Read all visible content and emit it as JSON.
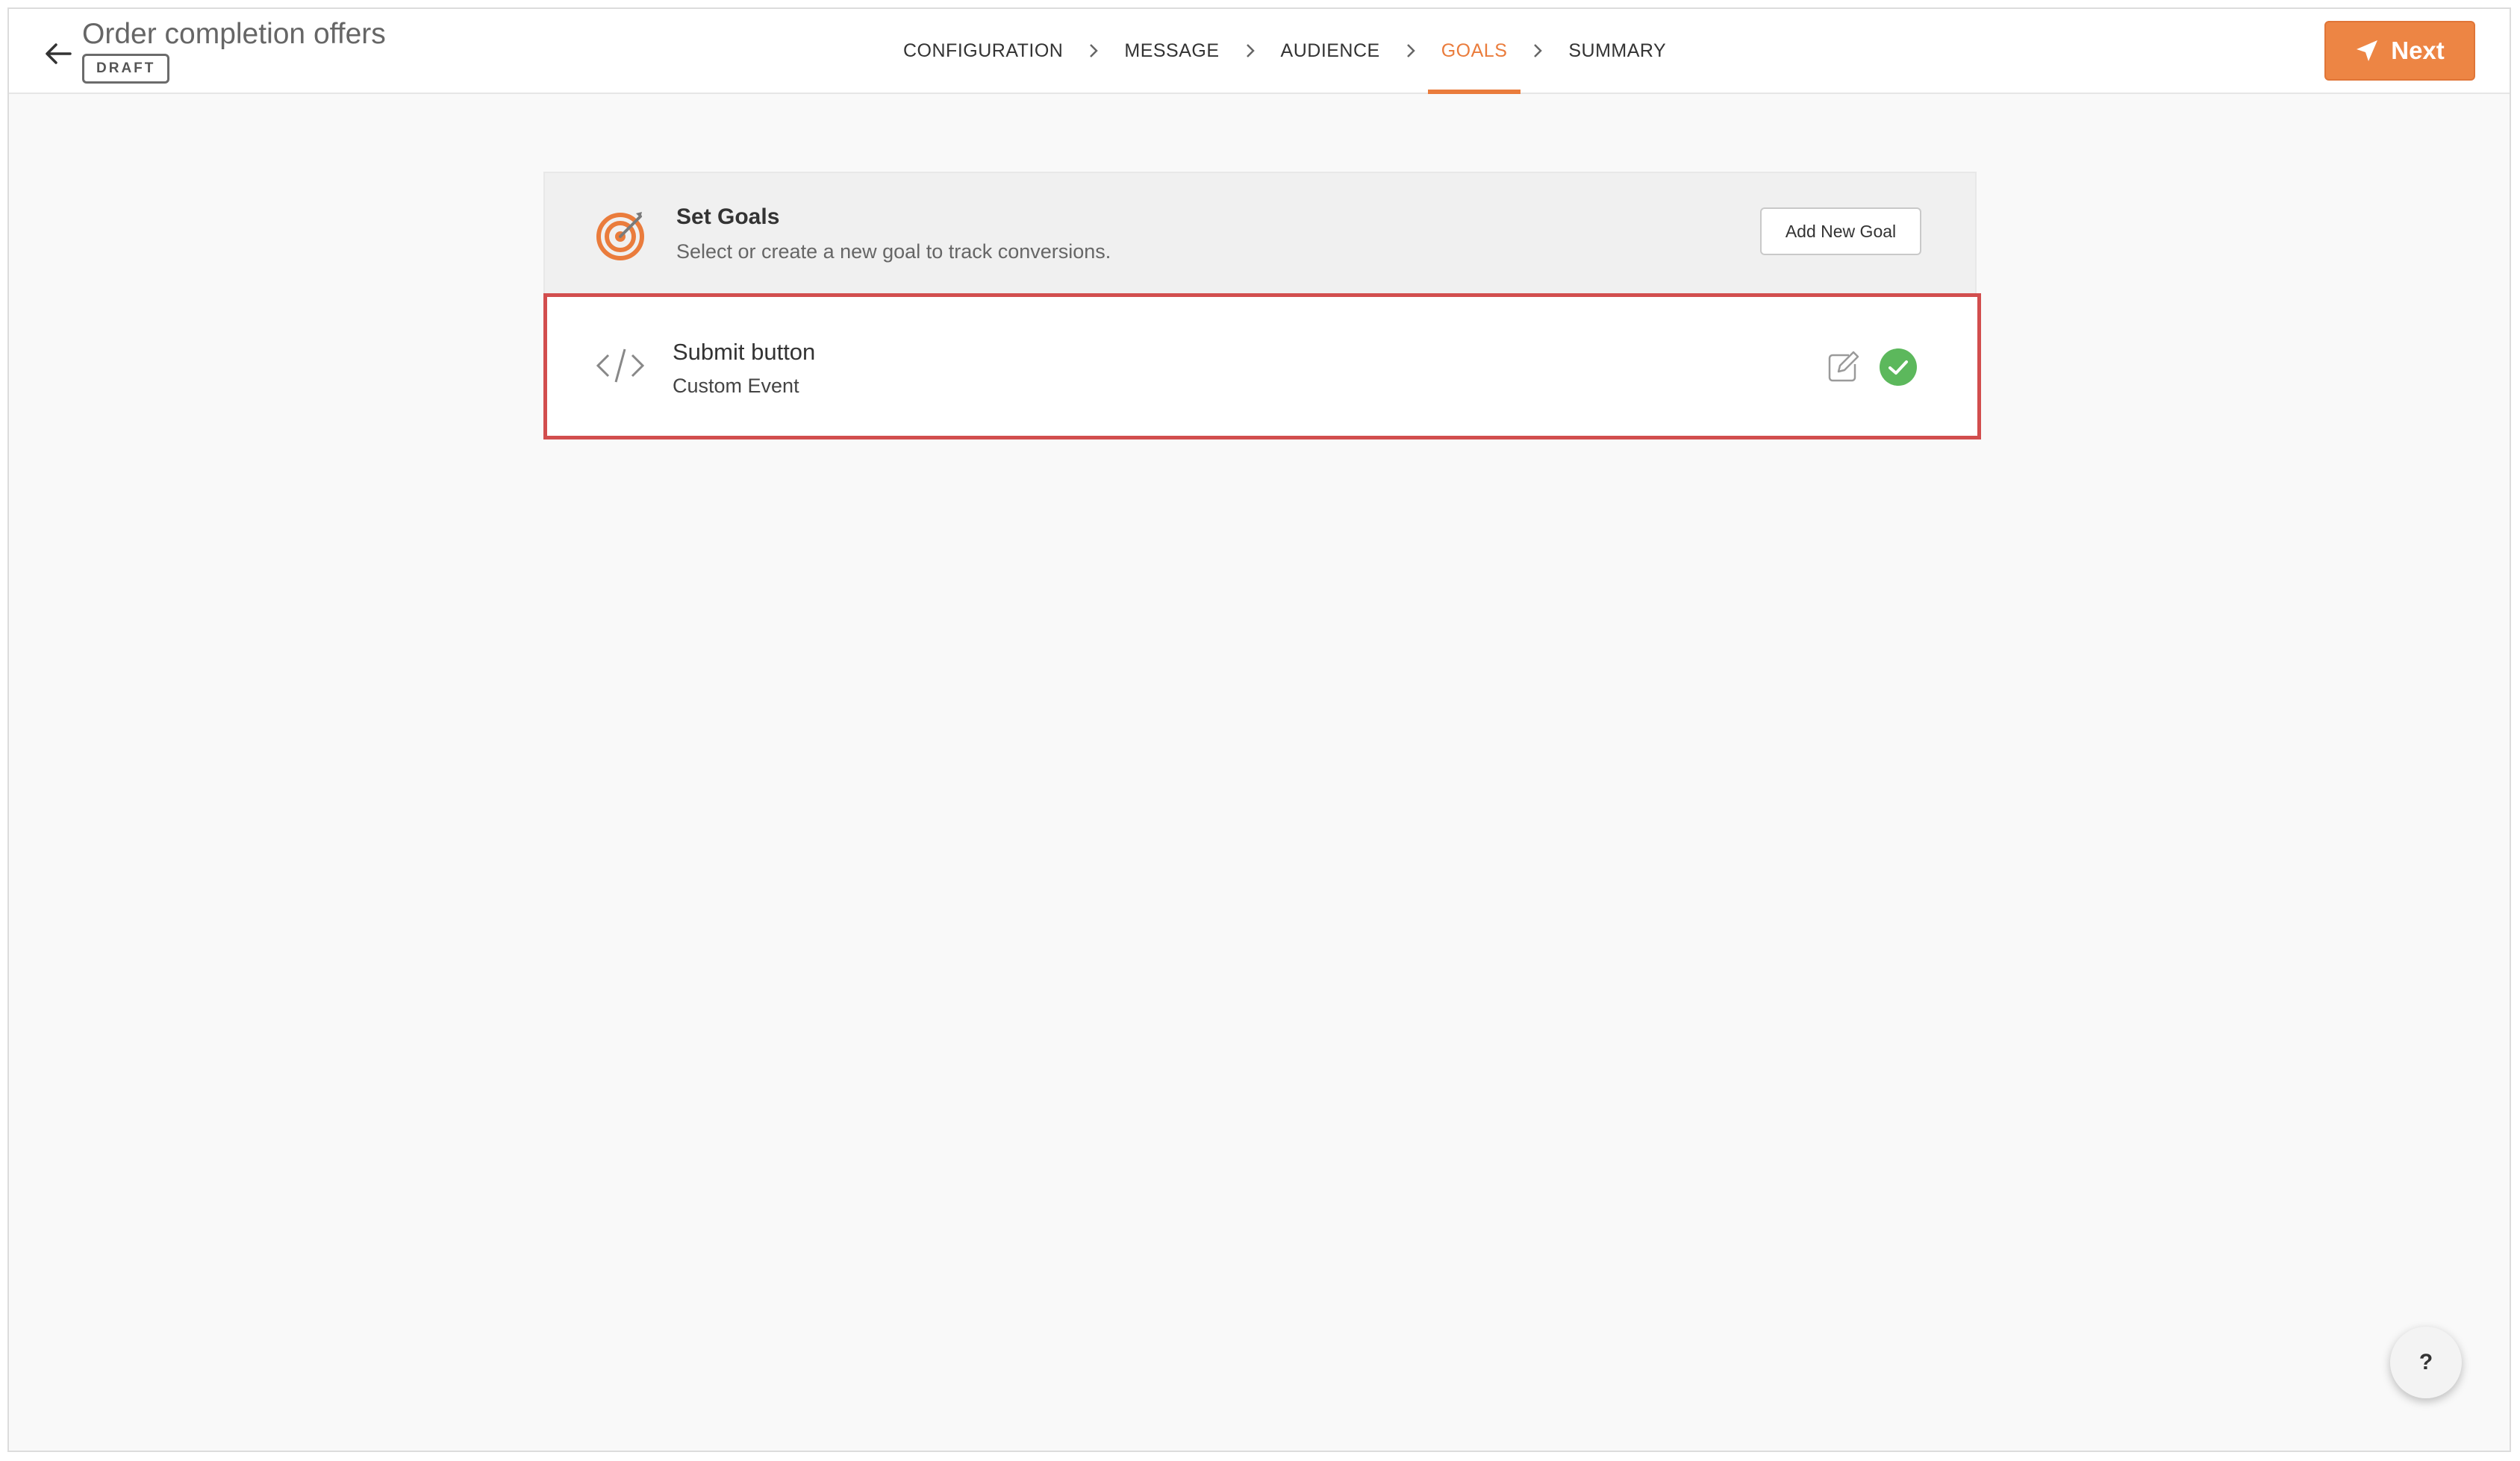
{
  "header": {
    "title": "Order completion offers",
    "status_badge": "DRAFT",
    "next_label": "Next"
  },
  "steps": [
    {
      "label": "CONFIGURATION",
      "active": false
    },
    {
      "label": "MESSAGE",
      "active": false
    },
    {
      "label": "AUDIENCE",
      "active": false
    },
    {
      "label": "GOALS",
      "active": true
    },
    {
      "label": "SUMMARY",
      "active": false
    }
  ],
  "goals": {
    "title": "Set Goals",
    "description": "Select or create a new goal to track conversions.",
    "add_button_label": "Add New Goal",
    "items": [
      {
        "name": "Submit button",
        "type": "Custom Event",
        "selected": true
      }
    ]
  },
  "help": {
    "label": "?"
  },
  "colors": {
    "accent": "#ea7c3c",
    "selected_border": "#d24e4e",
    "success": "#5cb85c"
  }
}
